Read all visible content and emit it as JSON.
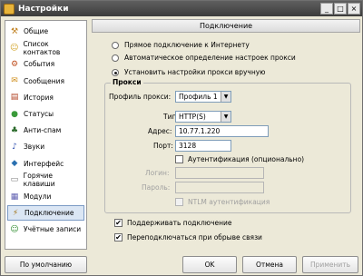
{
  "window": {
    "title": "Настройки",
    "buttons": [
      "_",
      "□",
      "×"
    ]
  },
  "sidebar": {
    "items": [
      {
        "label": "Общие",
        "icon": "tools-icon",
        "glyph": "⚒",
        "color": "#c08020",
        "active": false
      },
      {
        "label": "Список контактов",
        "icon": "contacts-icon",
        "glyph": "☺",
        "color": "#d0a020",
        "active": false
      },
      {
        "label": "События",
        "icon": "events-icon",
        "glyph": "⚙",
        "color": "#c05020",
        "active": false
      },
      {
        "label": "Сообщения",
        "icon": "messages-icon",
        "glyph": "✉",
        "color": "#d09020",
        "active": false
      },
      {
        "label": "История",
        "icon": "history-icon",
        "glyph": "▤",
        "color": "#b04020",
        "active": false
      },
      {
        "label": "Статусы",
        "icon": "status-icon",
        "glyph": "●",
        "color": "#3a9a3a",
        "active": false
      },
      {
        "label": "Анти-спам",
        "icon": "antispam-icon",
        "glyph": "♣",
        "color": "#2a6a2a",
        "active": false
      },
      {
        "label": "Звуки",
        "icon": "sound-icon",
        "glyph": "♪",
        "color": "#3050b0",
        "active": false
      },
      {
        "label": "Интерфейс",
        "icon": "interface-icon",
        "glyph": "◆",
        "color": "#2a70b0",
        "active": false
      },
      {
        "label": "Горячие клавиши",
        "icon": "hotkeys-icon",
        "glyph": "▭",
        "color": "#7a7a7a",
        "active": false
      },
      {
        "label": "Модули",
        "icon": "modules-icon",
        "glyph": "▦",
        "color": "#6060b0",
        "active": false
      },
      {
        "label": "Подключение",
        "icon": "connection-icon",
        "glyph": "⚡",
        "color": "#a07010",
        "active": true
      },
      {
        "label": "Учётные записи",
        "icon": "accounts-icon",
        "glyph": "☺",
        "color": "#2a8a2a",
        "active": false
      }
    ]
  },
  "header": {
    "title": "Подключение"
  },
  "connection": {
    "options": [
      {
        "label": "Прямое подключение к Интернету",
        "selected": false
      },
      {
        "label": "Автоматическое определение настроек прокси",
        "selected": false
      },
      {
        "label": "Установить настройки прокси вручную",
        "selected": true
      }
    ]
  },
  "proxy": {
    "group_label": "Прокси",
    "profile_label": "Профиль прокси:",
    "profile_value": "Профиль 1",
    "type_label": "Тип:",
    "type_value": "HTTP(S)",
    "address_label": "Адрес:",
    "address_value": "10.77.1.220",
    "port_label": "Порт:",
    "port_value": "3128",
    "auth_label": "Аутентификация (опционально)",
    "auth_checked": false,
    "login_label": "Логин:",
    "login_value": "",
    "password_label": "Пароль:",
    "password_value": "",
    "ntlm_label": "NTLM аутентификация",
    "ntlm_checked": false
  },
  "options": {
    "keep_alive_label": "Поддерживать подключение",
    "keep_alive_checked": true,
    "reconnect_label": "Переподключаться при обрыве связи",
    "reconnect_checked": true,
    "check_mark": "✔"
  },
  "footer": {
    "defaults_label": "По умолчанию",
    "ok_label": "OK",
    "cancel_label": "Отмена",
    "apply_label": "Применить"
  }
}
